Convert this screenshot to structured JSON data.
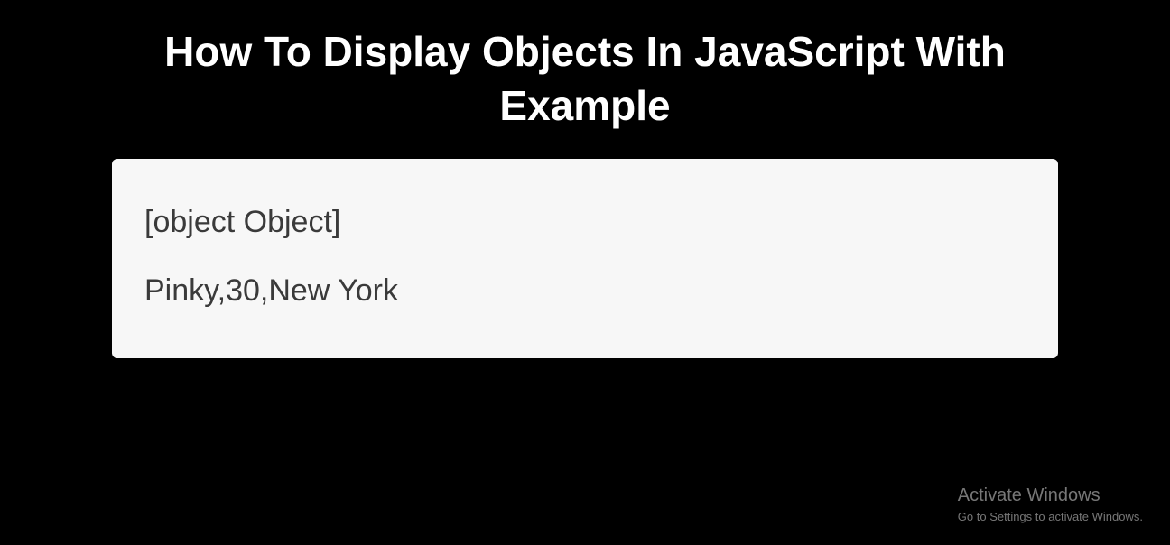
{
  "title": "How To Display Objects In JavaScript With Example",
  "output": {
    "line1": "[object Object]",
    "line2": "Pinky,30,New York"
  },
  "watermark": {
    "title": "Activate Windows",
    "subtitle": "Go to Settings to activate Windows."
  }
}
